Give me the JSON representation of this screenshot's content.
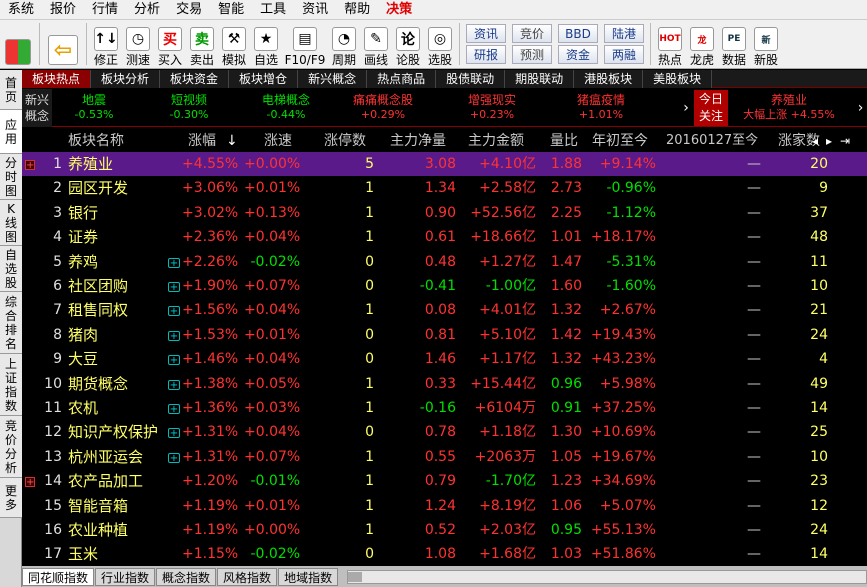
{
  "menu": [
    "系统",
    "报价",
    "行情",
    "分析",
    "交易",
    "智能",
    "工具",
    "资讯",
    "帮助",
    "决策"
  ],
  "menu_accent_index": 9,
  "toolbar": {
    "buttons": [
      {
        "label": "修正",
        "glyph": "↑↓",
        "icon": "up-down-arrows-icon"
      },
      {
        "label": "测速",
        "glyph": "◷",
        "icon": "speed-test-clock-icon"
      },
      {
        "label": "买入",
        "glyph": "买",
        "icon": "buy-icon"
      },
      {
        "label": "卖出",
        "glyph": "卖",
        "icon": "sell-icon"
      },
      {
        "label": "模拟",
        "glyph": "⚒",
        "icon": "gavel-icon"
      },
      {
        "label": "自选",
        "glyph": "★",
        "icon": "star-icon"
      },
      {
        "label": "F10/F9",
        "glyph": "▤",
        "icon": "f10-icon"
      },
      {
        "label": "周期",
        "glyph": "◔",
        "icon": "period-clock-icon"
      },
      {
        "label": "画线",
        "glyph": "✎",
        "icon": "pencil-icon"
      },
      {
        "label": "论股",
        "glyph": "论",
        "icon": "discuss-icon"
      },
      {
        "label": "选股",
        "glyph": "◎",
        "icon": "stock-pick-icon"
      }
    ],
    "small_buttons": [
      [
        "资讯",
        "研报"
      ],
      [
        "竞价",
        "预测"
      ],
      [
        "BBD",
        "资金"
      ],
      [
        "陆港",
        "两融"
      ]
    ],
    "right_buttons": [
      {
        "label": "热点",
        "glyph": "HOT",
        "icon": "hot-icon"
      },
      {
        "label": "龙虎",
        "glyph": "龙",
        "icon": "dragon-tiger-icon"
      },
      {
        "label": "数据",
        "glyph": "PE",
        "icon": "data-icon"
      },
      {
        "label": "新股",
        "glyph": "新",
        "icon": "new-stock-icon"
      }
    ]
  },
  "left_nav": [
    "首页",
    "应用",
    "分时图",
    "K线图",
    "自选股",
    "综合排名",
    "上证指数",
    "竞价分析",
    "更多"
  ],
  "sector_tabs": [
    "板块热点",
    "板块分析",
    "板块资金",
    "板块增仓",
    "新兴概念",
    "热点商品",
    "股债联动",
    "期股联动",
    "港股板块",
    "美股板块"
  ],
  "ticker": {
    "label": "新兴概念",
    "items": [
      {
        "name": "地震",
        "change": "-0.53%",
        "dir": "down"
      },
      {
        "name": "短视频",
        "change": "-0.30%",
        "dir": "down"
      },
      {
        "name": "电梯概念",
        "change": "-0.44%",
        "dir": "down"
      },
      {
        "name": "痛痛概念股",
        "change": "+0.29%",
        "dir": "up"
      },
      {
        "name": "增强现实",
        "change": "+0.23%",
        "dir": "up"
      },
      {
        "name": "猪瘟疫情",
        "change": "+1.01%",
        "dir": "up"
      }
    ],
    "arrow": "›",
    "focus_label": "今日关注",
    "focus_item": {
      "name": "养殖业",
      "sub": "大幅上涨 +4.55%"
    },
    "focus_arrow": "›"
  },
  "table": {
    "headers": [
      "板块名称",
      "涨幅",
      "涨速",
      "涨停数",
      "主力净量",
      "主力金额",
      "量比",
      "年初至今",
      "20160127至今",
      "涨家数"
    ],
    "sort_arrow": "↓",
    "col_nav": [
      "◂",
      "▸",
      "⇥"
    ],
    "rows": [
      {
        "idx": "1",
        "name": "养殖业",
        "chg": "+4.55%",
        "spd": "+0.00%",
        "lim": "5",
        "net": "3.08",
        "amt": "+4.10亿",
        "vol": "1.88",
        "ytd": "+9.14%",
        "since": "—",
        "cnt": "20",
        "selected": true,
        "expand": true,
        "plus": false
      },
      {
        "idx": "2",
        "name": "园区开发",
        "chg": "+3.06%",
        "spd": "+0.01%",
        "lim": "1",
        "net": "1.34",
        "amt": "+2.58亿",
        "vol": "2.73",
        "ytd": "-0.96%",
        "since": "—",
        "cnt": "9",
        "plus": false
      },
      {
        "idx": "3",
        "name": "银行",
        "chg": "+3.02%",
        "spd": "+0.13%",
        "lim": "1",
        "net": "0.90",
        "amt": "+52.56亿",
        "vol": "2.25",
        "ytd": "-1.12%",
        "since": "—",
        "cnt": "37",
        "plus": false
      },
      {
        "idx": "4",
        "name": "证券",
        "chg": "+2.36%",
        "spd": "+0.04%",
        "lim": "1",
        "net": "0.61",
        "amt": "+18.66亿",
        "vol": "1.01",
        "ytd": "+18.17%",
        "since": "—",
        "cnt": "48",
        "plus": false
      },
      {
        "idx": "5",
        "name": "养鸡",
        "chg": "+2.26%",
        "spd": "-0.02%",
        "lim": "0",
        "net": "0.48",
        "amt": "+1.27亿",
        "vol": "1.47",
        "ytd": "-5.31%",
        "since": "—",
        "cnt": "11",
        "plus": true
      },
      {
        "idx": "6",
        "name": "社区团购",
        "chg": "+1.90%",
        "spd": "+0.07%",
        "lim": "0",
        "net": "-0.41",
        "amt": "-1.00亿",
        "vol": "1.60",
        "ytd": "-1.60%",
        "since": "—",
        "cnt": "10",
        "plus": true
      },
      {
        "idx": "7",
        "name": "租售同权",
        "chg": "+1.56%",
        "spd": "+0.04%",
        "lim": "1",
        "net": "0.08",
        "amt": "+4.01亿",
        "vol": "1.32",
        "ytd": "+2.67%",
        "since": "—",
        "cnt": "21",
        "plus": true
      },
      {
        "idx": "8",
        "name": "猪肉",
        "chg": "+1.53%",
        "spd": "+0.01%",
        "lim": "0",
        "net": "0.81",
        "amt": "+5.10亿",
        "vol": "1.42",
        "ytd": "+19.43%",
        "since": "—",
        "cnt": "24",
        "plus": true
      },
      {
        "idx": "9",
        "name": "大豆",
        "chg": "+1.46%",
        "spd": "+0.04%",
        "lim": "0",
        "net": "1.46",
        "amt": "+1.17亿",
        "vol": "1.32",
        "ytd": "+43.23%",
        "since": "—",
        "cnt": "4",
        "plus": true
      },
      {
        "idx": "10",
        "name": "期货概念",
        "chg": "+1.38%",
        "spd": "+0.05%",
        "lim": "1",
        "net": "0.33",
        "amt": "+15.44亿",
        "vol": "0.96",
        "ytd": "+5.98%",
        "since": "—",
        "cnt": "49",
        "plus": true
      },
      {
        "idx": "11",
        "name": "农机",
        "chg": "+1.36%",
        "spd": "+0.03%",
        "lim": "1",
        "net": "-0.16",
        "amt": "+6104万",
        "vol": "0.91",
        "ytd": "+37.25%",
        "since": "—",
        "cnt": "14",
        "plus": true
      },
      {
        "idx": "12",
        "name": "知识产权保护",
        "chg": "+1.31%",
        "spd": "+0.04%",
        "lim": "0",
        "net": "0.78",
        "amt": "+1.18亿",
        "vol": "1.30",
        "ytd": "+10.69%",
        "since": "—",
        "cnt": "25",
        "plus": true
      },
      {
        "idx": "13",
        "name": "杭州亚运会",
        "chg": "+1.31%",
        "spd": "+0.07%",
        "lim": "1",
        "net": "0.55",
        "amt": "+2063万",
        "vol": "1.05",
        "ytd": "+19.67%",
        "since": "—",
        "cnt": "10",
        "plus": true
      },
      {
        "idx": "14",
        "name": "农产品加工",
        "chg": "+1.20%",
        "spd": "-0.01%",
        "lim": "1",
        "net": "0.79",
        "amt": "-1.70亿",
        "vol": "1.23",
        "ytd": "+34.69%",
        "since": "—",
        "cnt": "23",
        "plus": false,
        "expand": true
      },
      {
        "idx": "15",
        "name": "智能音箱",
        "chg": "+1.19%",
        "spd": "+0.01%",
        "lim": "1",
        "net": "1.24",
        "amt": "+8.19亿",
        "vol": "1.06",
        "ytd": "+5.07%",
        "since": "—",
        "cnt": "12",
        "plus": false
      },
      {
        "idx": "16",
        "name": "农业种植",
        "chg": "+1.19%",
        "spd": "+0.00%",
        "lim": "1",
        "net": "0.52",
        "amt": "+2.03亿",
        "vol": "0.95",
        "ytd": "+55.13%",
        "since": "—",
        "cnt": "24",
        "plus": false
      },
      {
        "idx": "17",
        "name": "玉米",
        "chg": "+1.15%",
        "spd": "-0.02%",
        "lim": "0",
        "net": "1.08",
        "amt": "+1.68亿",
        "vol": "1.03",
        "ytd": "+51.86%",
        "since": "—",
        "cnt": "14",
        "plus": false
      }
    ]
  },
  "bottom_tabs": [
    "同花顺指数",
    "行业指数",
    "概念指数",
    "风格指数",
    "地域指数"
  ],
  "colors": {
    "up": "#ff3232",
    "down": "#00e000",
    "neutral": "#e0e0e0",
    "name": "#ffff66",
    "selected": "#5a1a8a",
    "accent": "#e00000"
  }
}
